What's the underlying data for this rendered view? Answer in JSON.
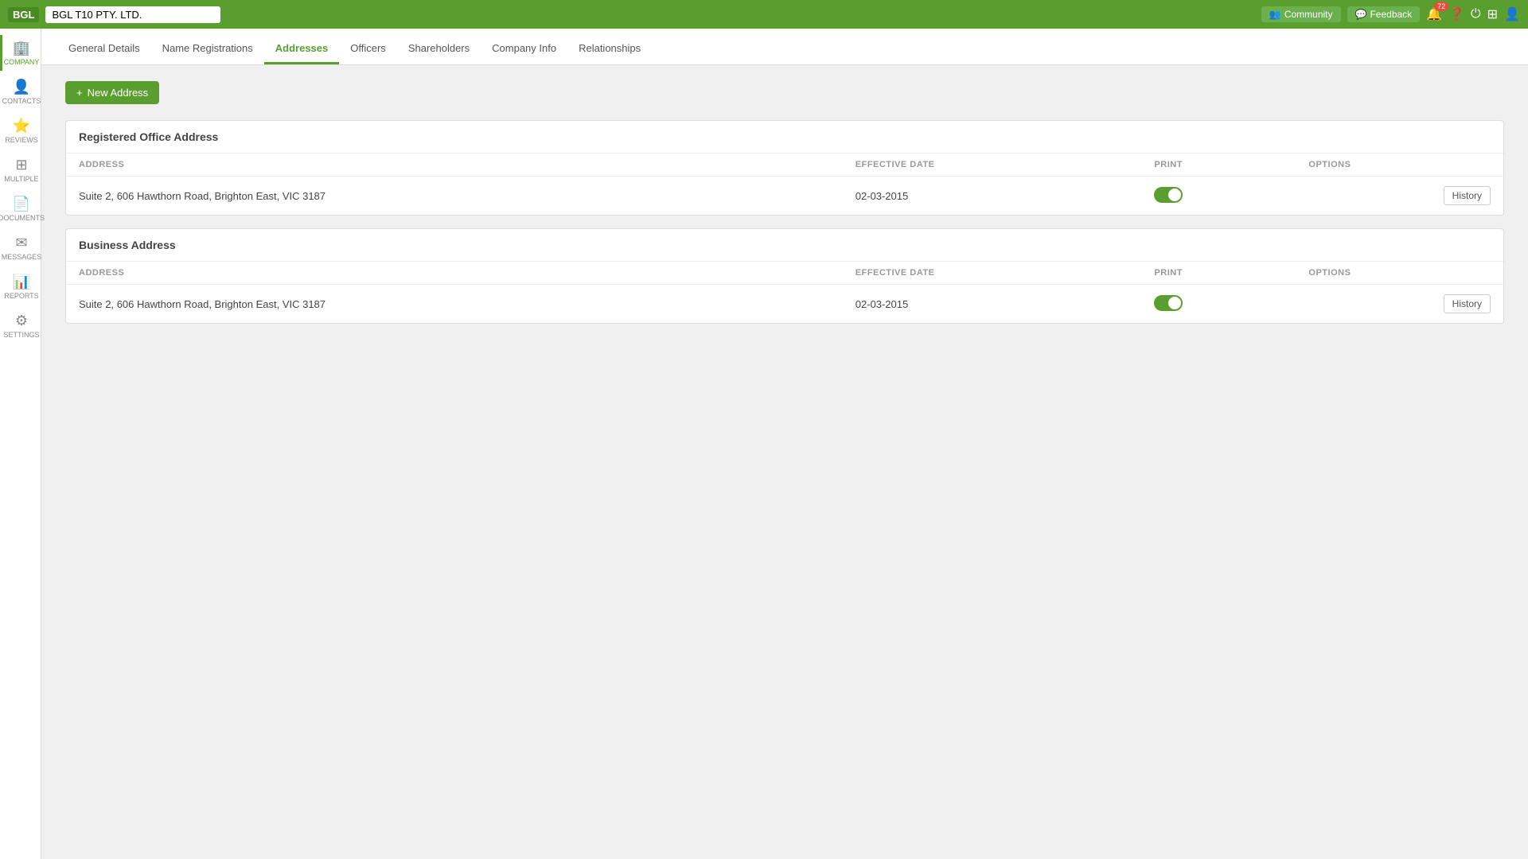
{
  "topbar": {
    "logo": "BGL",
    "company_name": "BGL T10 PTY. LTD.",
    "community_label": "Community",
    "feedback_label": "Feedback",
    "notification_count": "72"
  },
  "sidebar": {
    "items": [
      {
        "id": "company",
        "label": "COMPANY",
        "icon": "🏢"
      },
      {
        "id": "contacts",
        "label": "CONTACTS",
        "icon": "👤"
      },
      {
        "id": "reviews",
        "label": "REVIEWS",
        "icon": "⭐"
      },
      {
        "id": "multiple",
        "label": "MULTIPLE",
        "icon": "⊞"
      },
      {
        "id": "documents",
        "label": "DOCUMENTS",
        "icon": "📄"
      },
      {
        "id": "messages",
        "label": "MESSAGES",
        "icon": "✉"
      },
      {
        "id": "reports",
        "label": "REPORTS",
        "icon": "📊"
      },
      {
        "id": "settings",
        "label": "SETTINGS",
        "icon": "⚙"
      }
    ]
  },
  "tabs": [
    {
      "id": "general-details",
      "label": "General Details"
    },
    {
      "id": "name-registrations",
      "label": "Name Registrations"
    },
    {
      "id": "addresses",
      "label": "Addresses"
    },
    {
      "id": "officers",
      "label": "Officers"
    },
    {
      "id": "shareholders",
      "label": "Shareholders"
    },
    {
      "id": "company-info",
      "label": "Company Info"
    },
    {
      "id": "relationships",
      "label": "Relationships"
    }
  ],
  "active_tab": "addresses",
  "new_address_label": "New Address",
  "address_sections": [
    {
      "id": "registered",
      "title": "Registered Office Address",
      "columns": {
        "address": "ADDRESS",
        "effective_date": "EFFECTIVE DATE",
        "print": "PRINT",
        "options": "OPTIONS"
      },
      "rows": [
        {
          "address": "Suite 2, 606 Hawthorn Road, Brighton East, VIC 3187",
          "effective_date": "02-03-2015",
          "print_on": true,
          "history_label": "History"
        }
      ]
    },
    {
      "id": "business",
      "title": "Business Address",
      "columns": {
        "address": "ADDRESS",
        "effective_date": "EFFECTIVE DATE",
        "print": "PRINT",
        "options": "OPTIONS"
      },
      "rows": [
        {
          "address": "Suite 2, 606 Hawthorn Road, Brighton East, VIC 3187",
          "effective_date": "02-03-2015",
          "print_on": true,
          "history_label": "History"
        }
      ]
    }
  ],
  "colors": {
    "brand_green": "#5a9e2f",
    "active_green": "#5a9e2f"
  }
}
